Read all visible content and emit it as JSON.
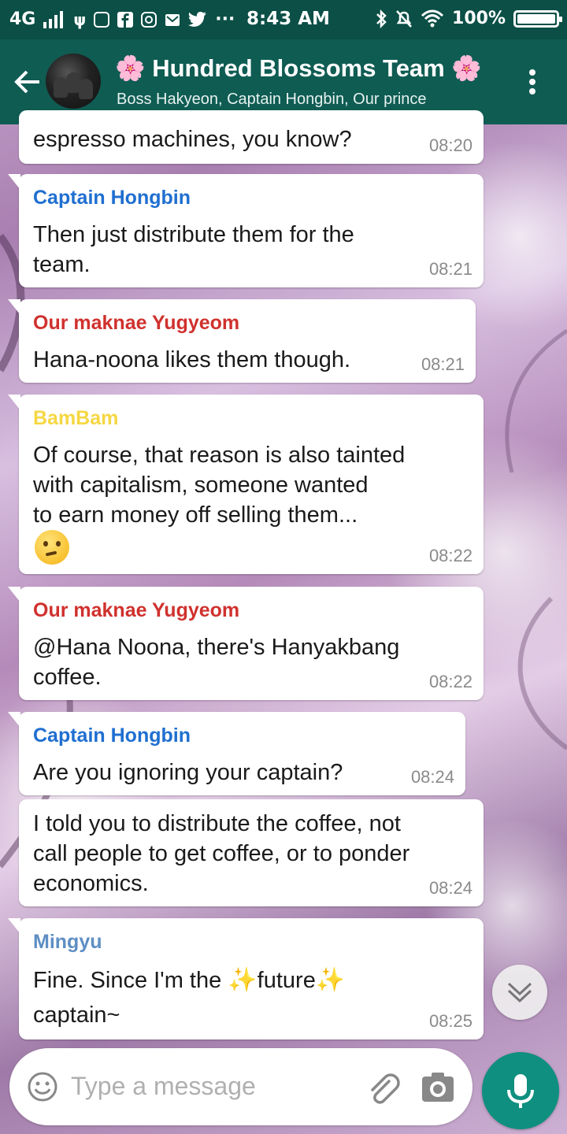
{
  "status_bar": {
    "network": "4G",
    "time": "8:43 AM",
    "battery": "100%"
  },
  "header": {
    "title": "Hundred Blossoms Team",
    "title_emoji": "🌸",
    "subtitle": "Boss Hakyeon, Captain Hongbin, Our prince"
  },
  "colors": {
    "header_bg": "#0f5c53",
    "status_bg": "#0b4f46",
    "captain_hongbin": "#1f6fd0",
    "yugyeom": "#d0312d",
    "bambam": "#f5d742",
    "mingyu": "#5e8ec4",
    "mic_button": "#0f8f7f"
  },
  "messages": [
    {
      "sender": "",
      "text": "espresso machines, you know?",
      "time": "08:20"
    },
    {
      "sender": "Captain Hongbin",
      "text": "Then just distribute them for the\nteam.",
      "time": "08:21"
    },
    {
      "sender": "Our maknae Yugyeom",
      "text": "Hana-noona likes them though.",
      "time": "08:21"
    },
    {
      "sender": "BamBam",
      "text": "Of course, that reason is also tainted\nwith capitalism, someone wanted\nto earn money off selling them...",
      "emoji": "thinking-face",
      "time": "08:22"
    },
    {
      "sender": "Our maknae Yugyeom",
      "text": "@Hana Noona, there's Hanyakbang\ncoffee.",
      "time": "08:22"
    },
    {
      "sender": "Captain Hongbin",
      "text": "Are you ignoring your captain?",
      "time": "08:24"
    },
    {
      "sender": "",
      "text": "I told you to distribute the coffee, not\ncall people to get coffee, or to ponder\neconomics.",
      "time": "08:24"
    },
    {
      "sender": "Mingyu",
      "text_before": "Fine. Since I'm the",
      "text_mid": "future",
      "text_after": "captain~",
      "time": "08:25"
    }
  ],
  "input": {
    "placeholder": "Type a message"
  }
}
